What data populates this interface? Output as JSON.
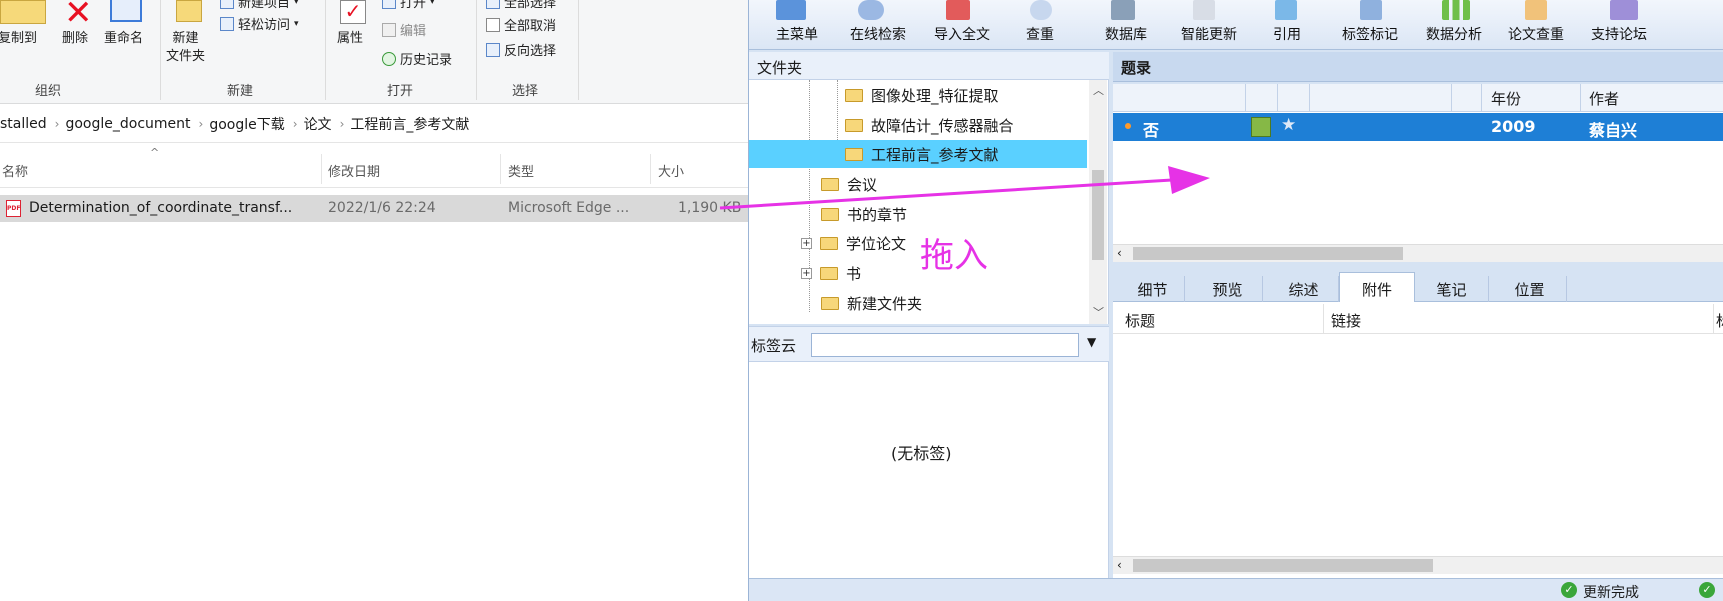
{
  "explorer": {
    "ribbon": {
      "copy_to": "复制到",
      "delete": "删除",
      "rename": "重命名",
      "new_folder": "新建\n文件夹",
      "new_item": "新建项目",
      "easy_access": "轻松访问",
      "properties": "属性",
      "open": "打开",
      "edit": "编辑",
      "history": "历史记录",
      "select_all": "全部选择",
      "select_none": "全部取消",
      "invert_select": "反向选择",
      "group_organize": "组织",
      "group_new": "新建",
      "group_open": "打开",
      "group_select": "选择"
    },
    "address": {
      "segments": [
        "stalled",
        "google_document",
        "google下载",
        "论文",
        "工程前言_参考文献"
      ]
    },
    "columns": {
      "name": "名称",
      "modified": "修改日期",
      "type": "类型",
      "size": "大小"
    },
    "file": {
      "name": "Determination_of_coordinate_transf...",
      "modified": "2022/1/6 22:24",
      "type": "Microsoft Edge ...",
      "size": "1,190 KB"
    }
  },
  "annotation": {
    "drag_label": "拖入",
    "color": "#e632e6"
  },
  "noteexpress": {
    "toolbar": [
      "主菜单",
      "在线检索",
      "导入全文",
      "查重",
      "数据库",
      "智能更新",
      "引用",
      "标签标记",
      "数据分析",
      "论文查重",
      "支持论坛"
    ],
    "folder_header": "文件夹",
    "tree": {
      "n1": "图像处理_特征提取",
      "n2": "故障估计_传感器融合",
      "n3": "工程前言_参考文献",
      "n4": "会议",
      "n5": "书的章节",
      "n6": "学位论文",
      "n7": "书",
      "n8": "新建文件夹"
    },
    "tagcloud_label": "标签云",
    "tagcloud_empty": "(无标签)",
    "records_header": "题录",
    "record_columns": {
      "year": "年份",
      "author": "作者"
    },
    "record": {
      "read": "否",
      "year": "2009",
      "author": "蔡自兴"
    },
    "tabs": [
      "细节",
      "预览",
      "综述",
      "附件",
      "笔记",
      "位置"
    ],
    "attach_columns": {
      "title": "标题",
      "link": "链接",
      "extra": "标"
    },
    "status": "更新完成",
    "colors": {
      "selected_row": "#1e7fd6",
      "highlight_folder": "#5ad0ff"
    }
  }
}
